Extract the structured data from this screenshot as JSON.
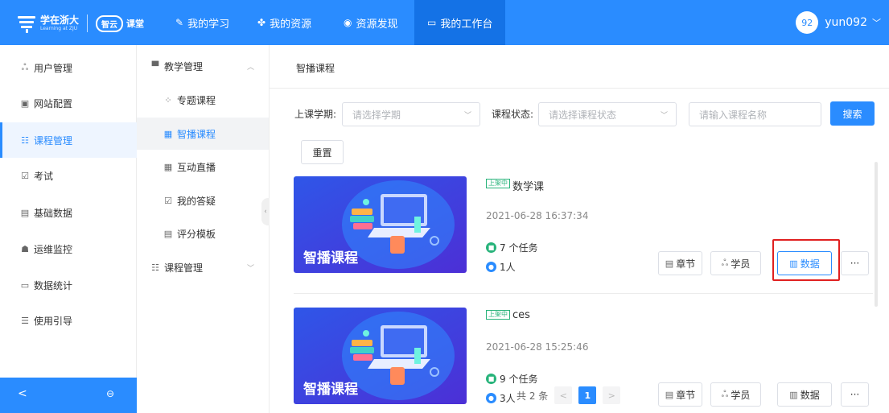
{
  "header": {
    "logo_text": "学在浙大",
    "logo_subtext": "Learning at ZJU",
    "logo_cloud": "智云",
    "logo_ke": "课堂",
    "nav": [
      {
        "label": "我的学习",
        "icon": "pencil-icon"
      },
      {
        "label": "我的资源",
        "icon": "resource-icon"
      },
      {
        "label": "资源发现",
        "icon": "discover-icon"
      },
      {
        "label": "我的工作台",
        "icon": "monitor-icon"
      }
    ],
    "avatar_text": "92",
    "username": "yun092"
  },
  "sidebar": {
    "items": [
      {
        "label": "用户管理"
      },
      {
        "label": "网站配置"
      },
      {
        "label": "课程管理"
      },
      {
        "label": "考试"
      },
      {
        "label": "基础数据"
      },
      {
        "label": "运维监控"
      },
      {
        "label": "数据统计"
      },
      {
        "label": "使用引导"
      }
    ],
    "collapse_glyph": "<",
    "lock_glyph": "⊖"
  },
  "subnav": {
    "group1": "教学管理",
    "children": [
      {
        "label": "专题课程"
      },
      {
        "label": "智播课程"
      },
      {
        "label": "互动直播"
      },
      {
        "label": "我的答疑"
      },
      {
        "label": "评分模板"
      }
    ],
    "group2": "课程管理"
  },
  "main": {
    "page_title": "智播课程",
    "filters": {
      "term_label": "上课学期:",
      "term_placeholder": "请选择学期",
      "status_label": "课程状态:",
      "status_placeholder": "请选择课程状态",
      "name_placeholder": "请输入课程名称",
      "search_label": "搜索",
      "reset_label": "重置"
    },
    "courses": [
      {
        "badge": "上架中",
        "title": "数学课",
        "date": "2021-06-28 16:37:34",
        "tasks": "7 个任务",
        "people": "1人",
        "thumb_caption": "智播课程"
      },
      {
        "badge": "上架中",
        "title": "ces",
        "date": "2021-06-28 15:25:46",
        "tasks": "9 个任务",
        "people": "3人",
        "thumb_caption": "智播课程"
      }
    ],
    "actions": {
      "chapters": "章节",
      "students": "学员",
      "data": "数据",
      "more": "···"
    },
    "pagination": {
      "total": "共 2 条",
      "current": "1",
      "prev": "<",
      "next": ">"
    }
  },
  "colors": {
    "brand": "#2a8cff",
    "success": "#27b37a",
    "highlight": "#e02020"
  }
}
